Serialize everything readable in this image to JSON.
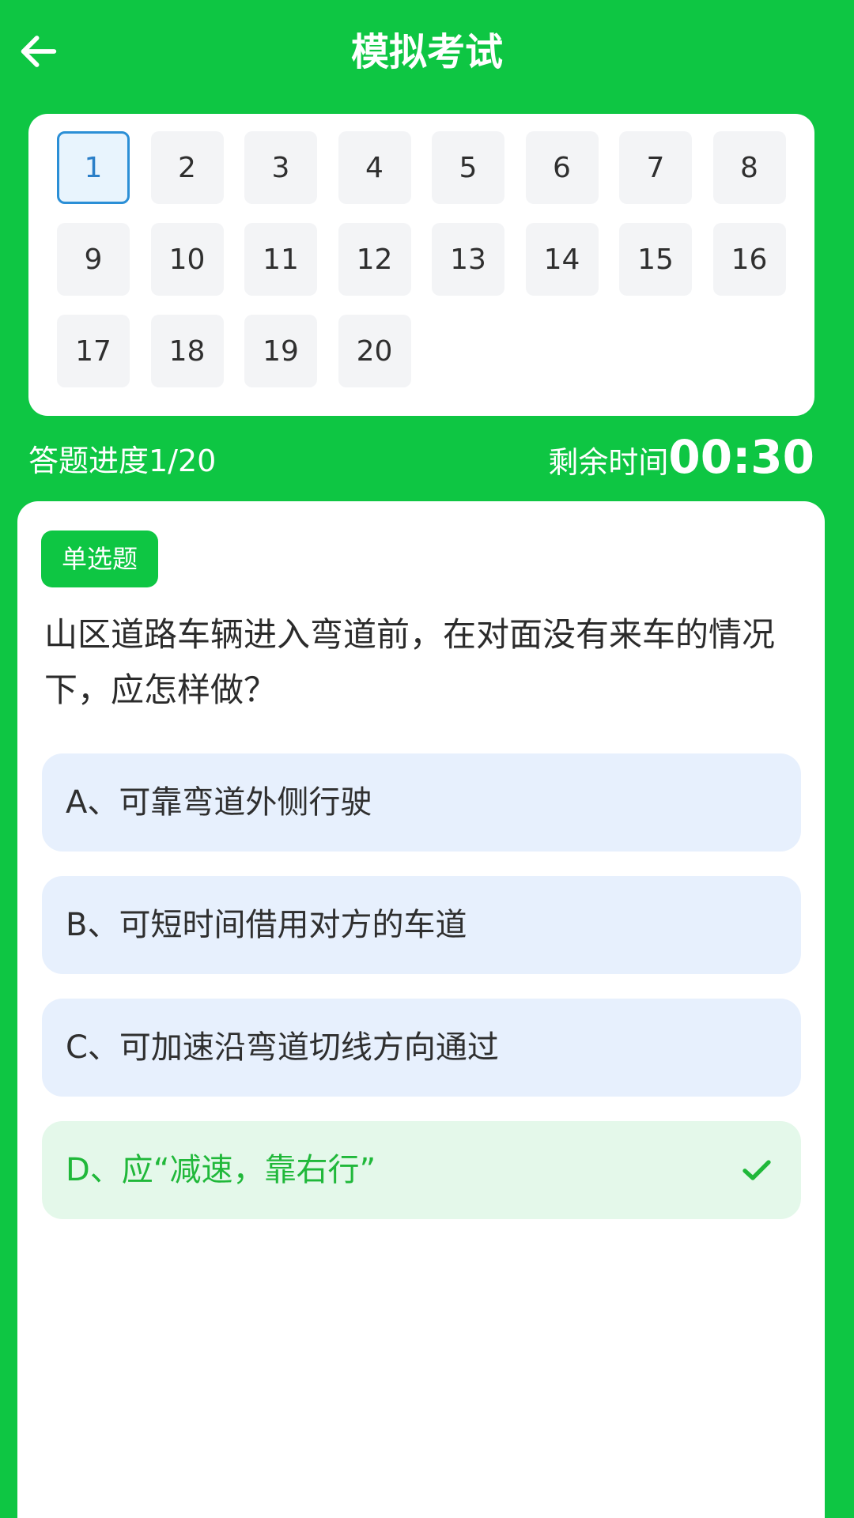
{
  "header": {
    "title": "模拟考试",
    "back_icon": "arrow-left-icon"
  },
  "question_grid": {
    "current": 1,
    "numbers": [
      "1",
      "2",
      "3",
      "4",
      "5",
      "6",
      "7",
      "8",
      "9",
      "10",
      "11",
      "12",
      "13",
      "14",
      "15",
      "16",
      "17",
      "18",
      "19",
      "20"
    ]
  },
  "progress": {
    "text": "答题进度1/20",
    "timer_label": "剩余时间",
    "timer_value": "00:30"
  },
  "question": {
    "type_badge": "单选题",
    "text": "山区道路车辆进入弯道前，在对面没有来车的情况下，应怎样做？",
    "options": [
      {
        "label": "A、可靠弯道外侧行驶",
        "state": "default"
      },
      {
        "label": "B、可短时间借用对方的车道",
        "state": "default"
      },
      {
        "label": "C、可加速沿弯道切线方向通过",
        "state": "default"
      },
      {
        "label": "D、应“减速，靠右行”",
        "state": "correct"
      }
    ]
  },
  "colors": {
    "brand_green": "#0ec643",
    "current_blue": "#2b8fd6",
    "option_blue_bg": "#e7f0fd",
    "correct_green_bg": "#e4f8ea",
    "correct_green_text": "#20b83a"
  }
}
